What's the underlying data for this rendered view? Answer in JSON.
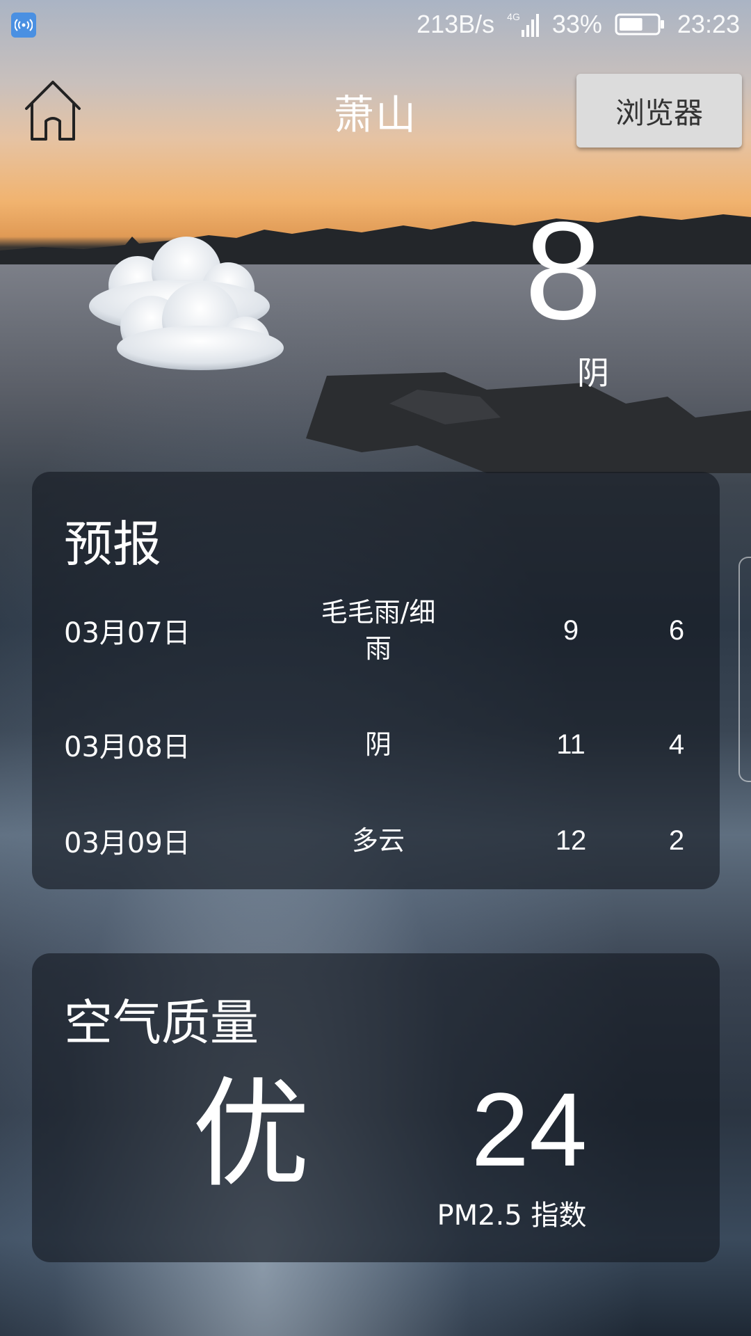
{
  "status_bar": {
    "hotspot_icon": "hotspot-icon",
    "network_speed": "213B/s",
    "network_type": "4G",
    "battery_percent": "33%",
    "battery_level": 0.33,
    "time": "23:23"
  },
  "header": {
    "home_icon": "home-icon",
    "city": "萧山",
    "browser_label": "浏览器"
  },
  "current": {
    "icon": "cloud-icon",
    "temperature": "8",
    "condition": "阴"
  },
  "forecast": {
    "title": "预报",
    "days": [
      {
        "date": "03月07日",
        "condition": "毛毛雨/细雨",
        "high": "9",
        "low": "6"
      },
      {
        "date": "03月08日",
        "condition": "阴",
        "high": "11",
        "low": "4"
      },
      {
        "date": "03月09日",
        "condition": "多云",
        "high": "12",
        "low": "2"
      }
    ]
  },
  "air_quality": {
    "title": "空气质量",
    "level": "优",
    "value": "24",
    "label": "PM2.5 指数"
  }
}
